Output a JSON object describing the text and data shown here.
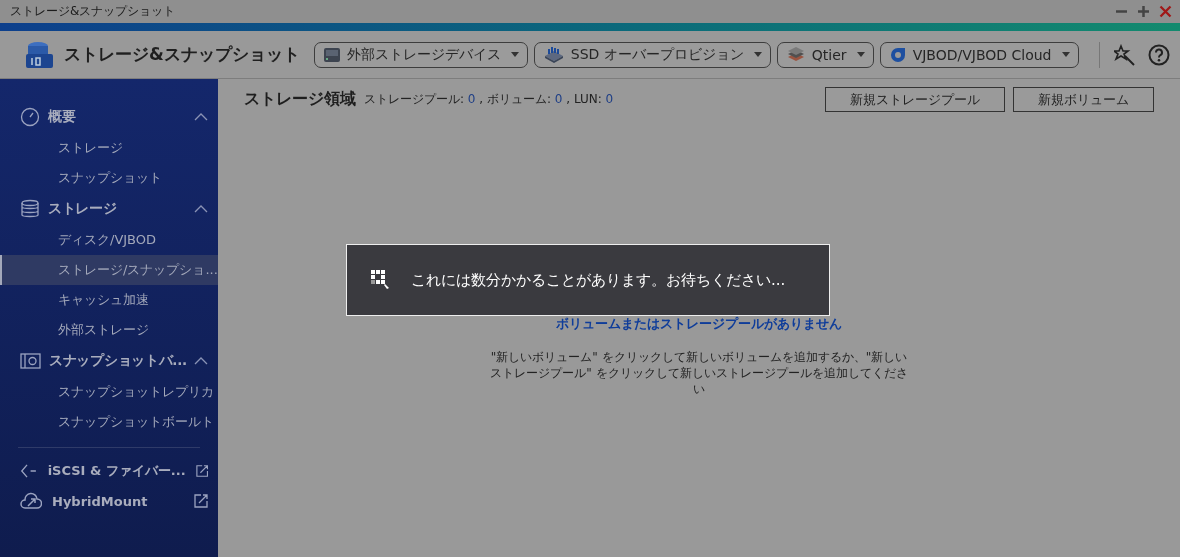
{
  "window": {
    "title": "ストレージ&スナップショット"
  },
  "toolbar": {
    "app_name": "ストレージ&スナップショット",
    "dropdowns": [
      {
        "label": "外部ストレージデバイス"
      },
      {
        "label": "SSD オーバープロビジョン"
      },
      {
        "label": "Qtier"
      },
      {
        "label": "VJBOD/VJBOD Cloud"
      }
    ]
  },
  "sidebar": {
    "groups": [
      {
        "label": "概要",
        "expanded": true,
        "children": [
          {
            "label": "ストレージ",
            "selected": false
          },
          {
            "label": "スナップショット",
            "selected": false
          }
        ]
      },
      {
        "label": "ストレージ",
        "expanded": true,
        "children": [
          {
            "label": "ディスク/VJBOD",
            "selected": false
          },
          {
            "label": "ストレージ/スナップショ...",
            "selected": true
          },
          {
            "label": "キャッシュ加速",
            "selected": false
          },
          {
            "label": "外部ストレージ",
            "selected": false
          }
        ]
      },
      {
        "label": "スナップショットバ...",
        "expanded": true,
        "children": [
          {
            "label": "スナップショットレプリカ",
            "selected": false
          },
          {
            "label": "スナップショットボールト",
            "selected": false
          }
        ]
      }
    ],
    "links": [
      {
        "label": "iSCSI & ファイバー..."
      },
      {
        "label": "HybridMount"
      }
    ]
  },
  "content": {
    "heading": "ストレージ領域",
    "stats": [
      {
        "label": "ストレージプール:",
        "value": "0"
      },
      {
        "label": ", ボリューム:",
        "value": "0"
      },
      {
        "label": ", LUN:",
        "value": "0"
      }
    ],
    "buttons": [
      "新規ストレージプール",
      "新規ボリューム"
    ],
    "empty_title": "ボリュームまたはストレージプールがありません",
    "empty_text": "\"新しいボリューム\" をクリックして新しいボリュームを追加するか、\"新しいストレージプール\" をクリックして新しいストレージプールを追加してください"
  },
  "dialog": {
    "message": "これには数分かかることがあります。お待ちください..."
  }
}
